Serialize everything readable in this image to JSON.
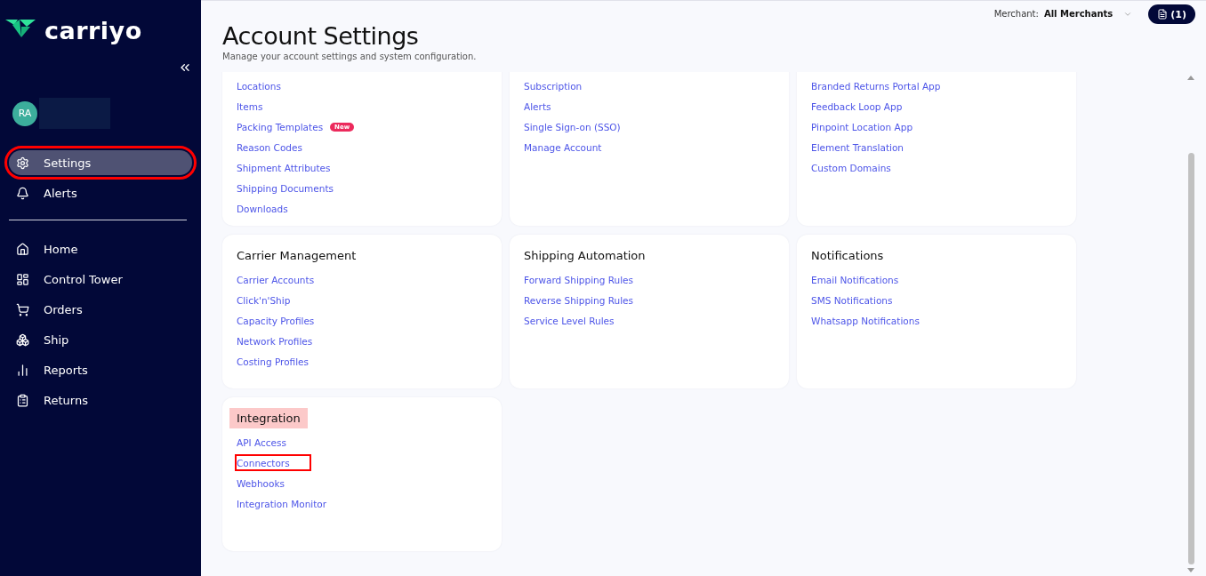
{
  "sidebar": {
    "logo": "carriyo",
    "user": {
      "initials": "RA"
    },
    "top_items": [
      {
        "label": "Settings",
        "selected": true,
        "outlined": true
      },
      {
        "label": "Alerts",
        "selected": false,
        "outlined": false
      }
    ],
    "nav_items": [
      {
        "label": "Home",
        "selected": false,
        "outlined": false
      },
      {
        "label": "Control Tower",
        "selected": false,
        "outlined": false
      },
      {
        "label": "Orders",
        "selected": false,
        "outlined": false
      },
      {
        "label": "Ship",
        "selected": false,
        "outlined": false
      },
      {
        "label": "Reports",
        "selected": false,
        "outlined": false
      },
      {
        "label": "Returns",
        "selected": false,
        "outlined": false
      }
    ]
  },
  "header": {
    "title": "Account Settings",
    "subtitle": "Manage your account settings and system configuration.",
    "merchant_label": "Merchant:",
    "merchant_value": "All Merchants",
    "notes_count": "(1)"
  },
  "cards": [
    {
      "links": [
        {
          "label": "Locations",
          "outlined": false
        },
        {
          "label": "Items",
          "outlined": false
        },
        {
          "label": "Packing Templates",
          "badge": "New",
          "outlined": false
        },
        {
          "label": "Reason Codes",
          "outlined": false
        },
        {
          "label": "Shipment Attributes",
          "outlined": false
        },
        {
          "label": "Shipping Documents",
          "outlined": false
        },
        {
          "label": "Downloads",
          "outlined": false
        }
      ]
    },
    {
      "links": [
        {
          "label": "Subscription",
          "outlined": false
        },
        {
          "label": "Alerts",
          "outlined": false
        },
        {
          "label": "Single Sign-on (SSO)",
          "outlined": false
        },
        {
          "label": "Manage Account",
          "outlined": false
        }
      ]
    },
    {
      "links": [
        {
          "label": "Branded Returns Portal App",
          "outlined": false
        },
        {
          "label": "Feedback Loop App",
          "outlined": false
        },
        {
          "label": "Pinpoint Location App",
          "outlined": false
        },
        {
          "label": "Element Translation",
          "outlined": false
        },
        {
          "label": "Custom Domains",
          "outlined": false
        }
      ]
    },
    {
      "title": "Carrier Management",
      "highlighted": false,
      "links": [
        {
          "label": "Carrier Accounts",
          "outlined": false
        },
        {
          "label": "Click'n'Ship",
          "outlined": false
        },
        {
          "label": "Capacity Profiles",
          "outlined": false
        },
        {
          "label": "Network Profiles",
          "outlined": false
        },
        {
          "label": "Costing Profiles",
          "outlined": false
        }
      ]
    },
    {
      "title": "Shipping Automation",
      "highlighted": false,
      "links": [
        {
          "label": "Forward Shipping Rules",
          "outlined": false
        },
        {
          "label": "Reverse Shipping Rules",
          "outlined": false
        },
        {
          "label": "Service Level Rules",
          "outlined": false
        }
      ]
    },
    {
      "title": "Notifications",
      "highlighted": false,
      "links": [
        {
          "label": "Email Notifications",
          "outlined": false
        },
        {
          "label": "SMS Notifications",
          "outlined": false
        },
        {
          "label": "Whatsapp Notifications",
          "outlined": false
        }
      ]
    },
    {
      "title": "Integration",
      "highlighted": true,
      "links": [
        {
          "label": "API Access",
          "outlined": false
        },
        {
          "label": "Connectors",
          "outlined": true
        },
        {
          "label": "Webhooks",
          "outlined": false
        },
        {
          "label": "Integration Monitor",
          "outlined": false
        }
      ]
    }
  ]
}
